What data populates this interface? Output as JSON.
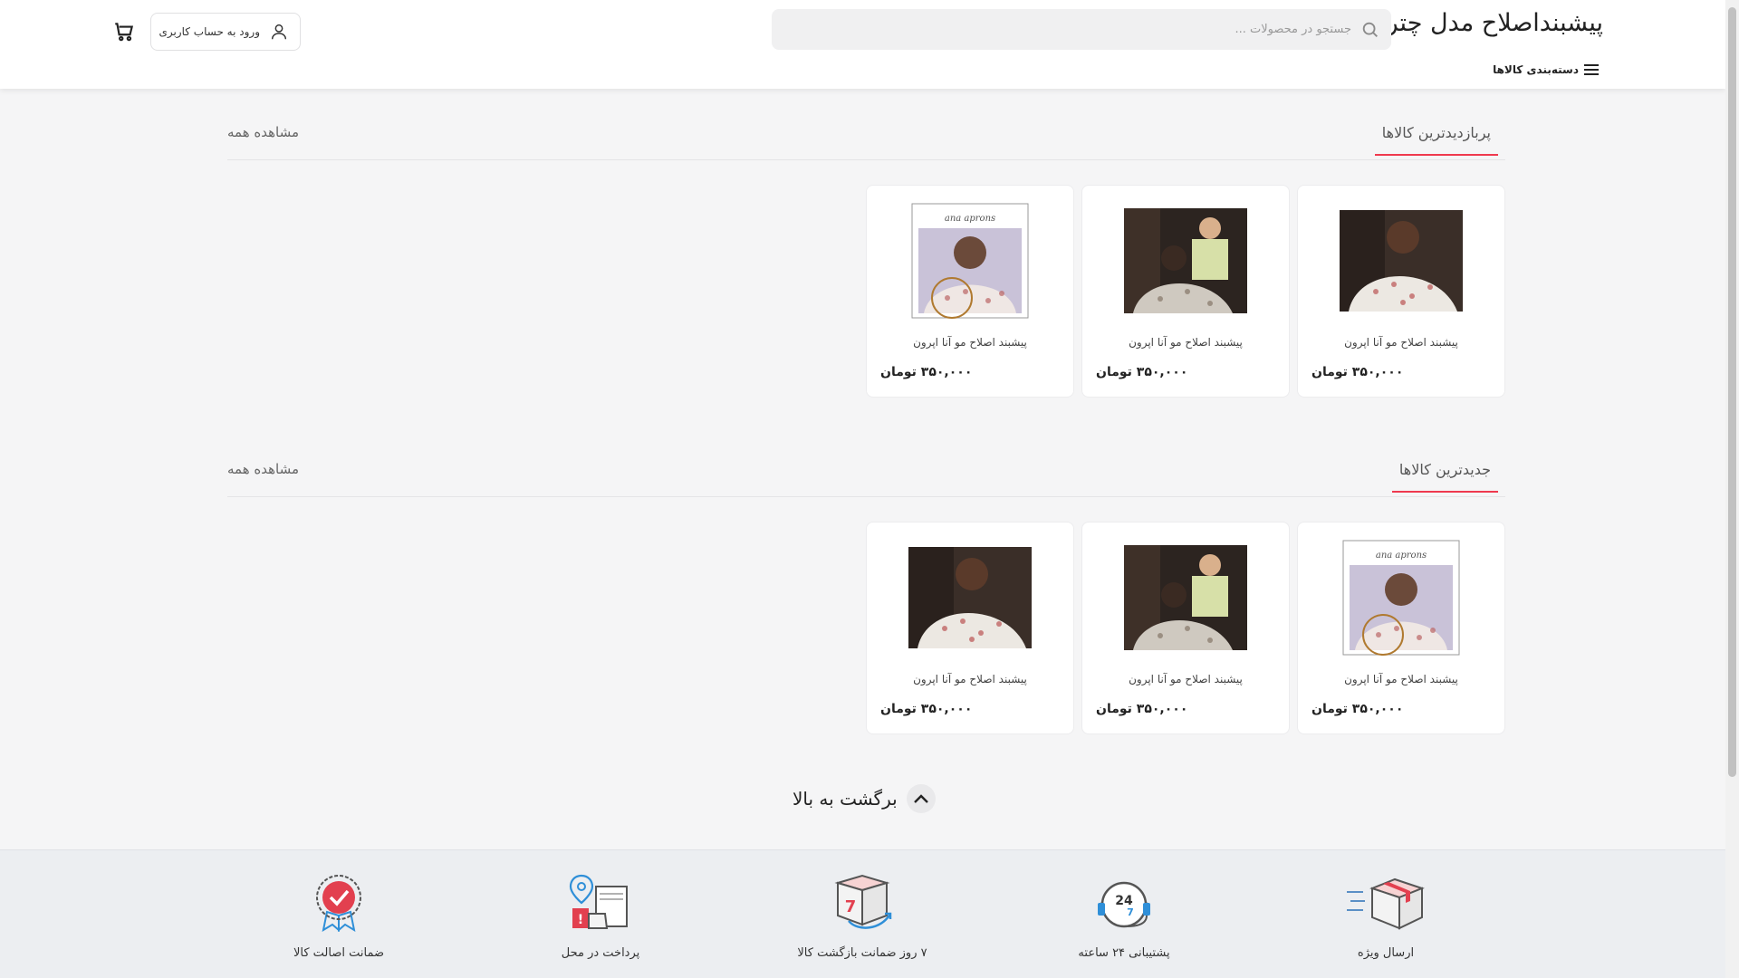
{
  "header": {
    "site_title": "پیشبنداصلاح مدل چتر",
    "search_placeholder": "جستجو در محصولات ...",
    "login_label": "ورود به حساب کاربری",
    "categories_label": "دسته‌بندی کالاها"
  },
  "sections": [
    {
      "title": "پربازدیدترین کالاها",
      "view_all": "مشاهده همه",
      "products": [
        {
          "name": "پیشبند اصلاح مو آنا اپرون",
          "price": "۳۵۰,۰۰۰ تومان",
          "image": "cape-woman-seated"
        },
        {
          "name": "پیشبند اصلاح مو آنا اپرون",
          "price": "۳۵۰,۰۰۰ تومان",
          "image": "barber-cutting-child"
        },
        {
          "name": "پیشبند اصلاح مو آنا اپرون",
          "price": "۳۵۰,۰۰۰ تومان",
          "image": "cape-branded-product"
        }
      ]
    },
    {
      "title": "جدیدترین کالاها",
      "view_all": "مشاهده همه",
      "products": [
        {
          "name": "پیشبند اصلاح مو آنا اپرون",
          "price": "۳۵۰,۰۰۰ تومان",
          "image": "cape-branded-product"
        },
        {
          "name": "پیشبند اصلاح مو آنا اپرون",
          "price": "۳۵۰,۰۰۰ تومان",
          "image": "barber-cutting-child"
        },
        {
          "name": "پیشبند اصلاح مو آنا اپرون",
          "price": "۳۵۰,۰۰۰ تومان",
          "image": "cape-woman-seated"
        }
      ]
    }
  ],
  "back_to_top": "برگشت به بالا",
  "features": [
    {
      "label": "ارسال ویژه",
      "icon": "fast-delivery-icon"
    },
    {
      "label": "پشتیبانی ۲۴ ساعته",
      "icon": "support-24-icon"
    },
    {
      "label": "۷ روز ضمانت بازگشت کالا",
      "icon": "return-7-days-icon"
    },
    {
      "label": "پرداخت در محل",
      "icon": "cash-on-delivery-icon"
    },
    {
      "label": "ضمانت اصالت کالا",
      "icon": "authenticity-badge-icon"
    }
  ],
  "colors": {
    "accent": "#ef394e",
    "footer_bg": "#eceef1"
  }
}
